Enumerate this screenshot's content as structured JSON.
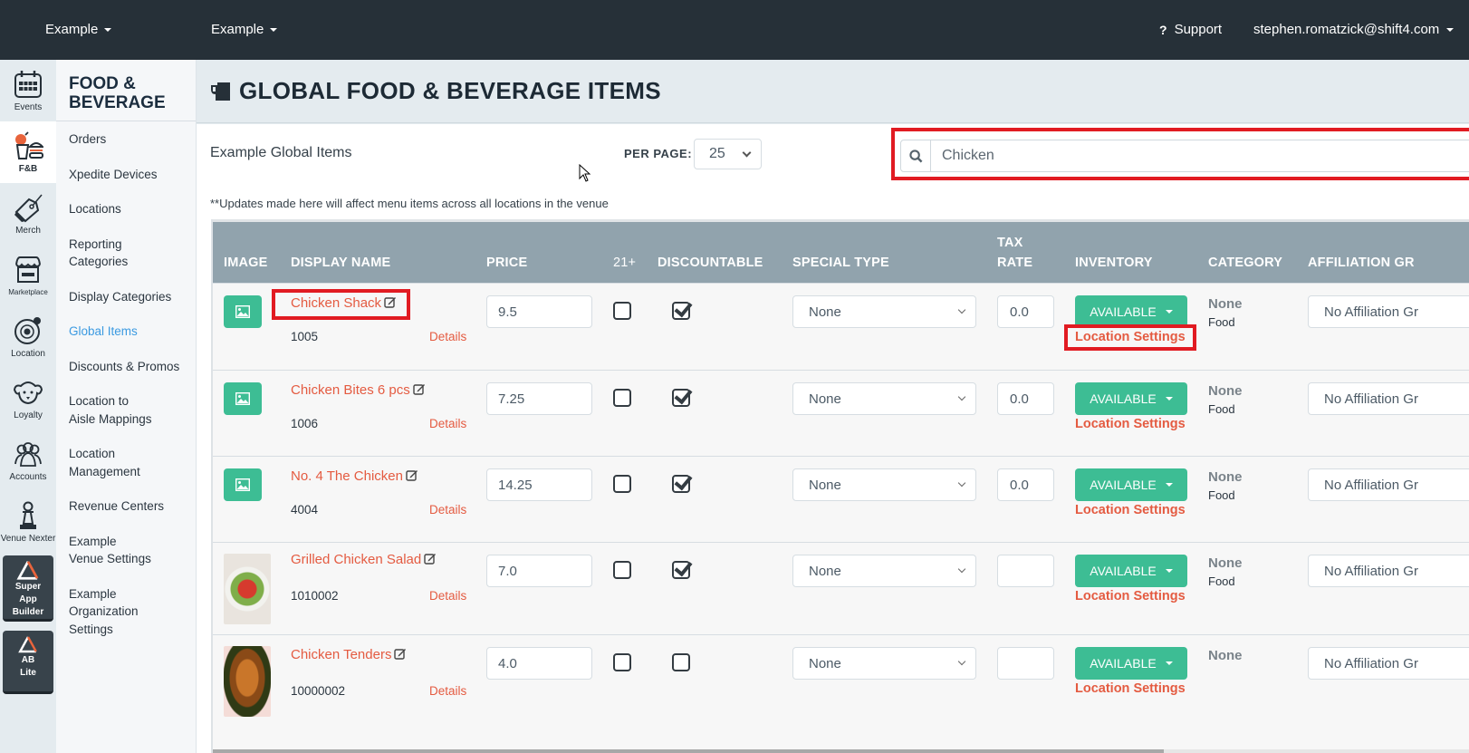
{
  "topbar": {
    "org_dropdown": "Example",
    "venue_dropdown": "Example",
    "support_label": "Support",
    "user_email": "stephen.romatzick@shift4.com"
  },
  "rail": {
    "items": [
      {
        "label": "Events",
        "icon": "calendar-icon"
      },
      {
        "label": "F&B",
        "icon": "food-beverage-icon",
        "active": true
      },
      {
        "label": "Merch",
        "icon": "tag-icon"
      },
      {
        "label": "Marketplace",
        "icon": "storefront-icon"
      },
      {
        "label": "Location",
        "icon": "location-target-icon"
      },
      {
        "label": "Loyalty",
        "icon": "dog-icon"
      },
      {
        "label": "Accounts",
        "icon": "users-icon"
      },
      {
        "label": "Venue Nexter",
        "icon": "chess-pawn-icon"
      }
    ],
    "apps": [
      {
        "label": "Super App Builder",
        "icon": "triangle-logo-icon"
      },
      {
        "label": "AB Lite",
        "icon": "triangle-logo-icon"
      }
    ]
  },
  "subnav": {
    "title": "FOOD & BEVERAGE",
    "items": [
      {
        "label": "Orders"
      },
      {
        "label": "Xpedite Devices"
      },
      {
        "label": "Locations"
      },
      {
        "label": "Reporting Categories"
      },
      {
        "label": "Display Categories"
      },
      {
        "label": "Global Items",
        "active": true
      },
      {
        "label": "Discounts & Promos"
      },
      {
        "label": "Location to Aisle Mappings"
      },
      {
        "label": "Location Management"
      },
      {
        "label": "Revenue Centers"
      },
      {
        "label": "Example Venue Settings"
      },
      {
        "label": "Example Organization Settings"
      }
    ]
  },
  "page": {
    "title": "GLOBAL FOOD & BEVERAGE ITEMS",
    "subtitle": "Example Global Items",
    "per_page_label": "PER PAGE:",
    "per_page_value": "25",
    "search_value": "Chicken",
    "note": "**Updates made here will affect menu items across all locations in the venue"
  },
  "table": {
    "headers": {
      "image": "IMAGE",
      "display_name": "DISPLAY NAME",
      "price": "PRICE",
      "age": "21+",
      "discountable": "DISCOUNTABLE",
      "special_type": "SPECIAL TYPE",
      "tax_rate_1": "TAX",
      "tax_rate_2": "RATE",
      "inventory": "INVENTORY",
      "category": "CATEGORY",
      "affiliation": "AFFILIATION GR"
    },
    "details_label": "Details",
    "location_settings_label": "Location Settings",
    "rows": [
      {
        "name": "Chicken Shack",
        "plu": "1005",
        "price": "9.5",
        "age21": false,
        "discountable": true,
        "special_type": "None",
        "tax_rate": "0.0",
        "inventory": "AVAILABLE",
        "category": "None",
        "category_sub": "Food",
        "affiliation": "No Affiliation Gr",
        "image": "placeholder"
      },
      {
        "name": "Chicken Bites 6 pcs",
        "plu": "1006",
        "price": "7.25",
        "age21": false,
        "discountable": true,
        "special_type": "None",
        "tax_rate": "0.0",
        "inventory": "AVAILABLE",
        "category": "None",
        "category_sub": "Food",
        "affiliation": "No Affiliation Gr",
        "image": "placeholder"
      },
      {
        "name": "No. 4 The Chicken",
        "plu": "4004",
        "price": "14.25",
        "age21": false,
        "discountable": true,
        "special_type": "None",
        "tax_rate": "0.0",
        "inventory": "AVAILABLE",
        "category": "None",
        "category_sub": "Food",
        "affiliation": "No Affiliation Gr",
        "image": "placeholder"
      },
      {
        "name": "Grilled Chicken Salad",
        "plu": "1010002",
        "price": "7.0",
        "age21": false,
        "discountable": true,
        "special_type": "None",
        "tax_rate": "",
        "inventory": "AVAILABLE",
        "category": "None",
        "category_sub": "Food",
        "affiliation": "No Affiliation Gr",
        "image": "salad-photo"
      },
      {
        "name": "Chicken Tenders",
        "plu": "10000002",
        "price": "4.0",
        "age21": false,
        "discountable": false,
        "special_type": "None",
        "tax_rate": "",
        "inventory": "AVAILABLE",
        "category": "None",
        "category_sub": "",
        "affiliation": "No Affiliation Gr",
        "image": "tenders-photo"
      }
    ]
  },
  "colors": {
    "topbar": "#263038",
    "accent_green": "#3dbd94",
    "link_red": "#e45b41",
    "highlight_red": "#e11b22",
    "active_nav_blue": "#3b9ae1",
    "table_header": "#91a3ad"
  }
}
